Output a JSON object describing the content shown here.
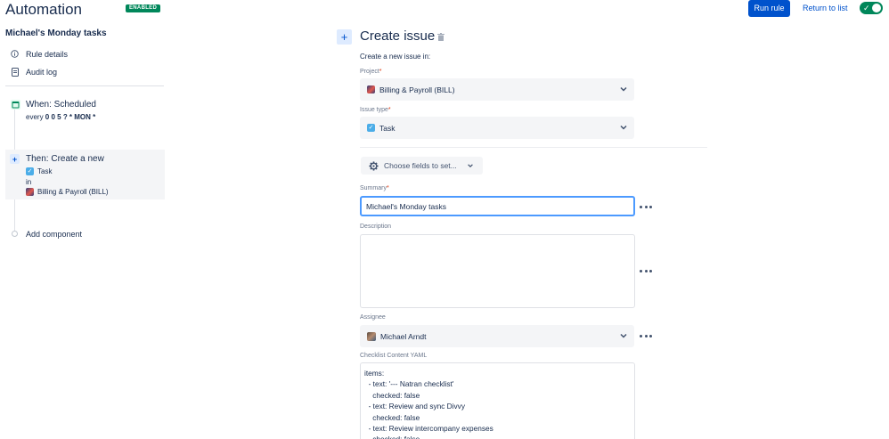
{
  "header": {
    "title": "Automation",
    "badge": "ENABLED",
    "run_rule": "Run rule",
    "return_link": "Return to list",
    "toggle_on": true
  },
  "sidebar": {
    "rule_name": "Michael's Monday tasks",
    "links": [
      {
        "label": "Rule details",
        "icon": "info-icon"
      },
      {
        "label": "Audit log",
        "icon": "document-icon"
      }
    ],
    "when": {
      "title": "When: Scheduled",
      "every": "every",
      "cron": "0 0 5 ? * MON *",
      "icon": "calendar-icon"
    },
    "then": {
      "title": "Then: Create a new",
      "issue_type": "Task",
      "in": "in",
      "project": "Billing & Payroll (BILL)",
      "icon": "plus-icon"
    },
    "add_component": "Add component"
  },
  "panel": {
    "title": "Create issue",
    "intro": "Create a new issue in:",
    "project_label": "Project",
    "project_value": "Billing & Payroll (BILL)",
    "issue_type_label": "Issue type",
    "issue_type_value": "Task",
    "choose_fields": "Choose fields to set...",
    "summary_label": "Summary",
    "summary_value": "Michael's Monday tasks",
    "description_label": "Description",
    "description_value": "",
    "assignee_label": "Assignee",
    "assignee_value": "Michael Arndt",
    "checklist_label": "Checklist Content YAML",
    "checklist_value": "items:\n  - text: '--- Natran checklist'\n    checked: false\n  - text: Review and sync Divvy\n    checked: false\n  - text: Review intercompany expenses\n    checked: false",
    "required_mark": "*"
  },
  "colors": {
    "primary": "#0052cc",
    "success": "#00875a",
    "text": "#172b4d",
    "subtle": "#6b778c",
    "focus": "#4c9aff"
  }
}
